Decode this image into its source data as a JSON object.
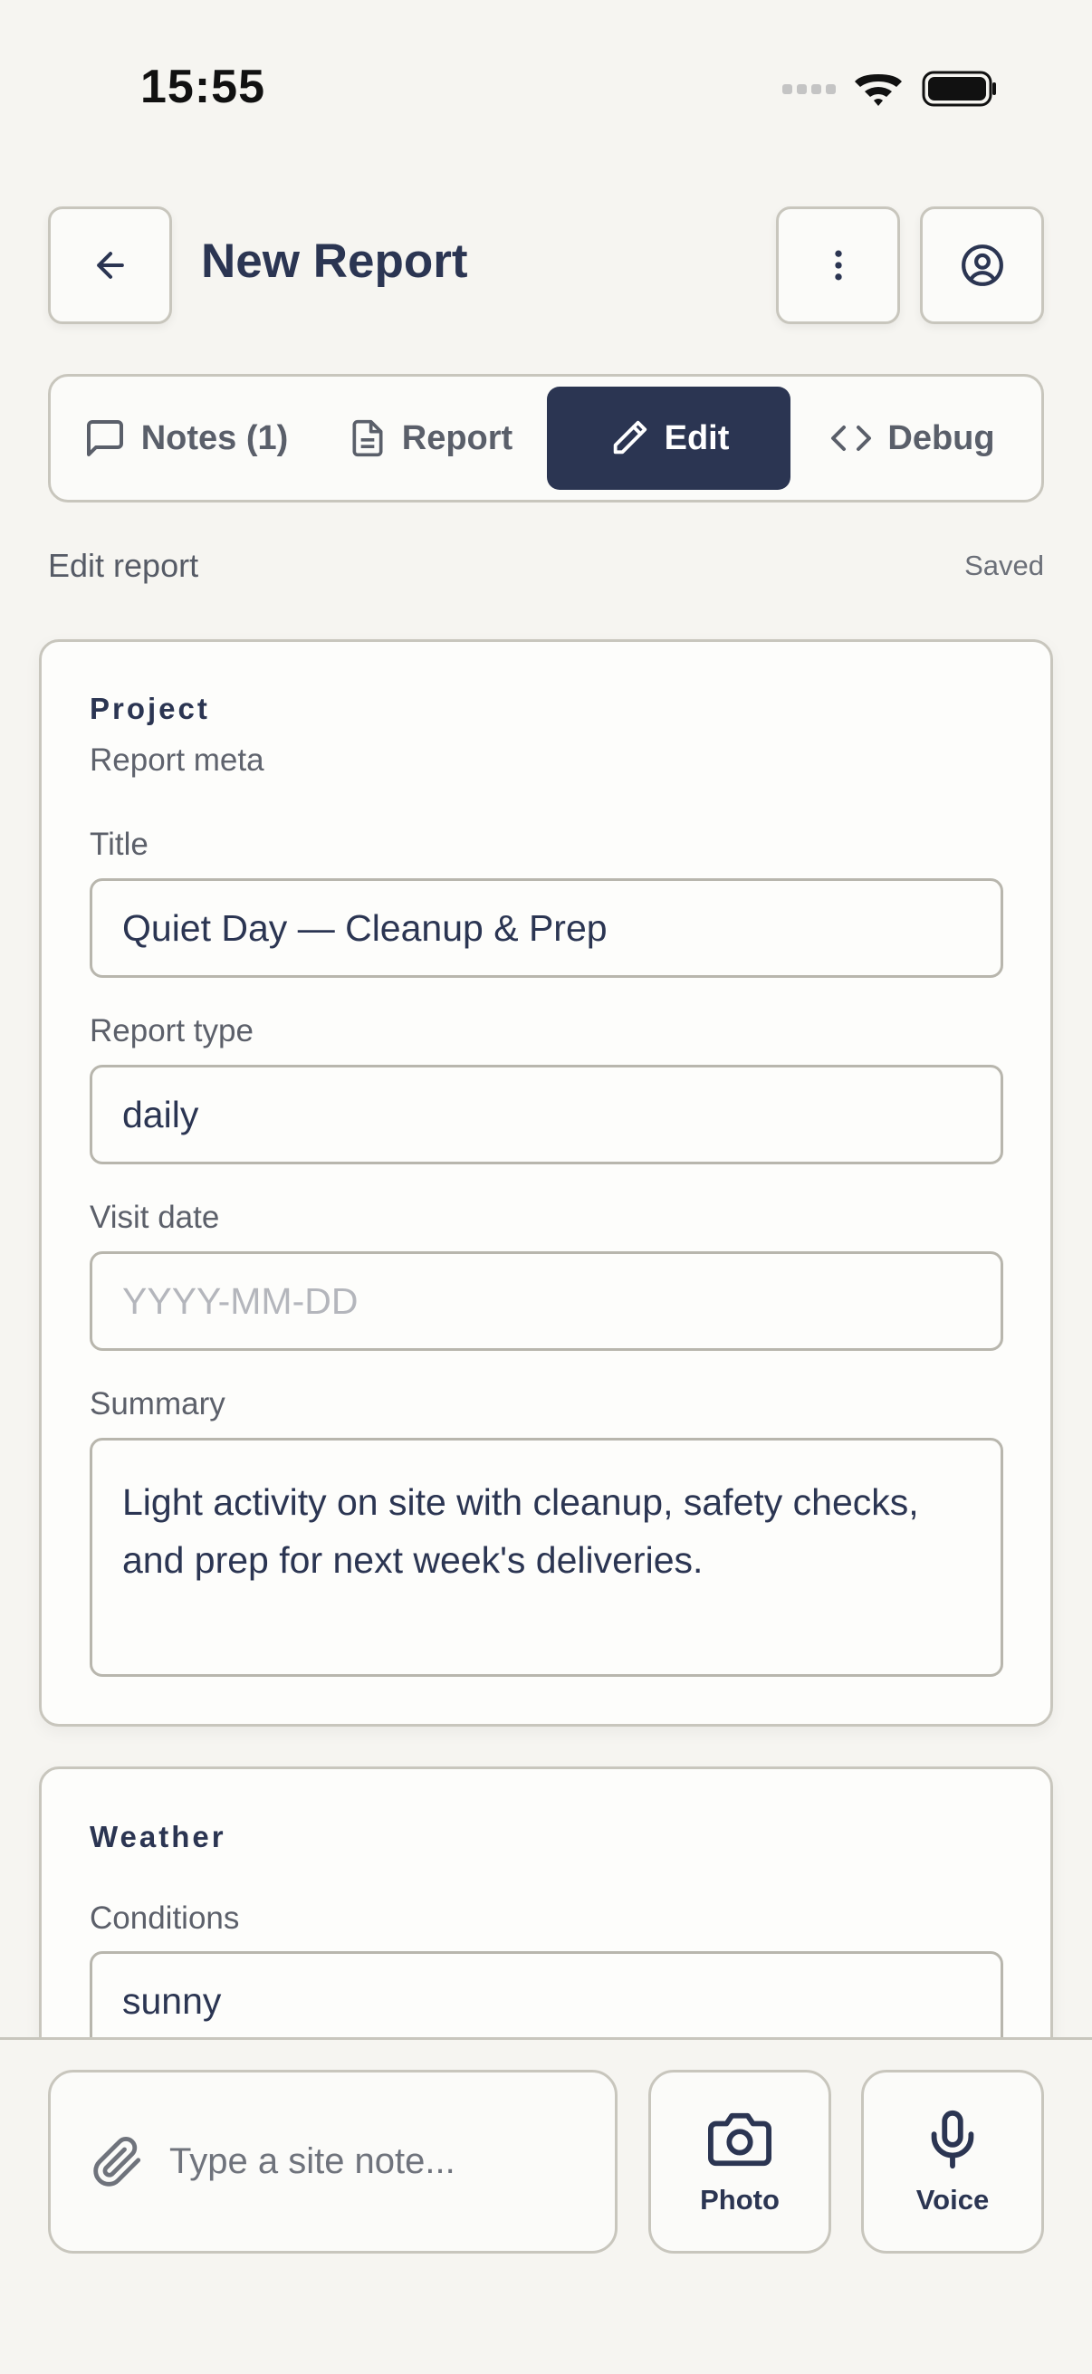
{
  "status_bar": {
    "time": "15:55"
  },
  "header": {
    "title": "New Report"
  },
  "tabs": [
    {
      "label": "Notes (1)",
      "icon": "message-square-icon"
    },
    {
      "label": "Report",
      "icon": "file-text-icon"
    },
    {
      "label": "Edit",
      "icon": "pencil-icon",
      "active": true
    },
    {
      "label": "Debug",
      "icon": "code-icon"
    }
  ],
  "subheader": {
    "left": "Edit report",
    "right": "Saved"
  },
  "project_card": {
    "title": "Project",
    "subtitle": "Report meta",
    "fields": {
      "title_label": "Title",
      "title_value": "Quiet Day — Cleanup & Prep",
      "type_label": "Report type",
      "type_value": "daily",
      "date_label": "Visit date",
      "date_placeholder": "YYYY-MM-DD",
      "summary_label": "Summary",
      "summary_value": "Light activity on site with cleanup, safety checks, and prep for next week's deliveries."
    }
  },
  "weather_card": {
    "title": "Weather",
    "conditions_label": "Conditions",
    "conditions_value": "sunny"
  },
  "bottom_bar": {
    "note_placeholder": "Type a site note...",
    "photo_label": "Photo",
    "voice_label": "Voice"
  },
  "colors": {
    "accent": "#2b3552",
    "background": "#f6f5f1",
    "border": "#c8c6bd"
  }
}
